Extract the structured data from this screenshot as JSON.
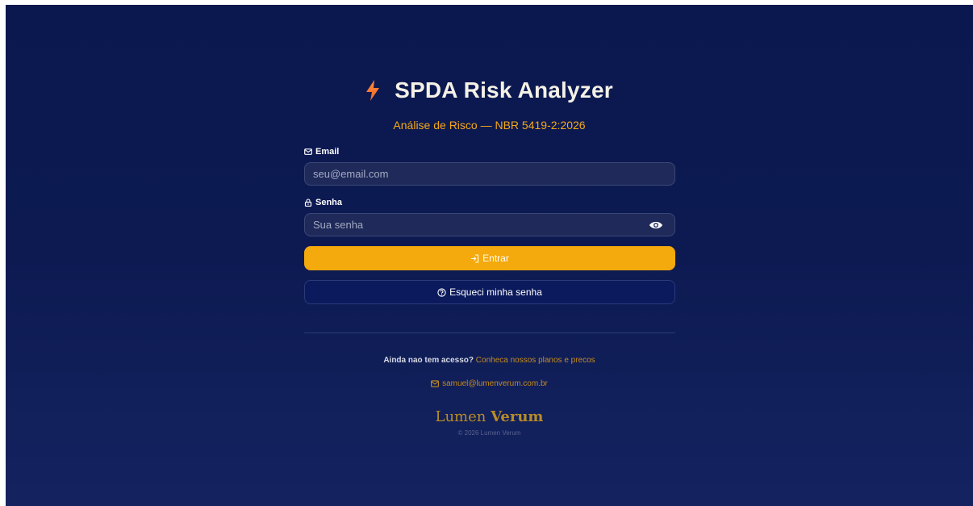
{
  "app": {
    "title": "SPDA Risk Analyzer",
    "subtitle": "Análise de Risco — NBR 5419-2:2026"
  },
  "form": {
    "email_label": "Email",
    "email_placeholder": "seu@email.com",
    "email_value": "",
    "password_label": "Senha",
    "password_placeholder": "Sua senha",
    "password_value": "",
    "submit_label": "Entrar",
    "forgot_label": "Esqueci minha senha"
  },
  "footer": {
    "access_question": "Ainda nao tem acesso?",
    "access_link": "Conheca nossos planos e precos",
    "contact_email": "samuel@lumenverum.com.br",
    "brand_light": "Lumen",
    "brand_strong": "Verum",
    "copyright": "© 2026 Lumen Verum"
  },
  "icons": {
    "logo": "lightning-bolt-icon",
    "email": "envelope-icon",
    "password": "lock-icon",
    "toggle_password": "eye-icon",
    "submit": "login-arrow-icon",
    "forgot": "question-circle-icon",
    "contact": "envelope-icon"
  },
  "colors": {
    "accent": "#f4a90c",
    "subtitle": "#f5a817",
    "background": "#0d1a52",
    "brand": "#b78c27"
  }
}
